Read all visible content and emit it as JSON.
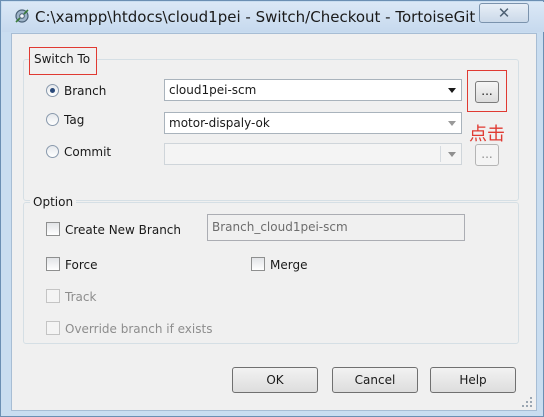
{
  "window": {
    "title": "C:\\xampp\\htdocs\\cloud1pei - Switch/Checkout - TortoiseGit",
    "close_glyph": "✕"
  },
  "switch_to": {
    "legend": "Switch To",
    "branch_label": "Branch",
    "branch_value": "cloud1pei-scm",
    "tag_label": "Tag",
    "tag_value": "motor-dispaly-ok",
    "commit_label": "Commit",
    "commit_value": "",
    "browse_label": "...",
    "annotation": "点击",
    "selected": "branch"
  },
  "option": {
    "legend": "Option",
    "create_new_branch_label": "Create New Branch",
    "new_branch_name": "Branch_cloud1pei-scm",
    "force_label": "Force",
    "merge_label": "Merge",
    "track_label": "Track",
    "override_label": "Override branch if exists"
  },
  "buttons": {
    "ok": "OK",
    "cancel": "Cancel",
    "help": "Help"
  },
  "colors": {
    "annotation": "#e03a32",
    "title_bar": "#c9ddf0"
  },
  "icons": {
    "app": "tortoisegit-switch-icon",
    "close": "close-icon",
    "resize": "resize-grip-icon"
  }
}
